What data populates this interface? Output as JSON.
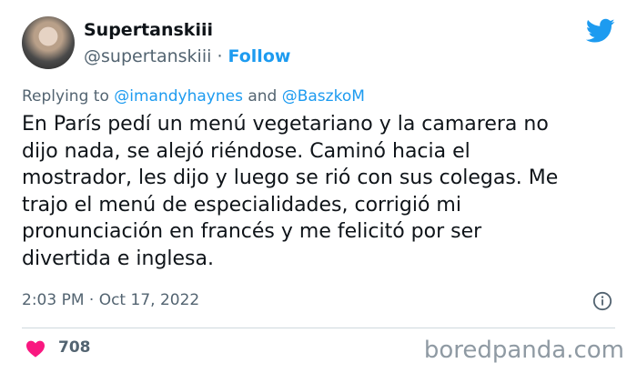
{
  "author": {
    "name": "Supertanskiii",
    "handle": "@supertanskiii",
    "separator": "·",
    "follow_label": "Follow"
  },
  "reply": {
    "prefix": "Replying to",
    "mention1": "@imandyhaynes",
    "joiner": "and",
    "mention2": "@BaszkoM"
  },
  "tweet": {
    "lines": [
      "En París pedí un menú vegetariano y la camarera no",
      "dijo nada, se alejó riéndose. Caminó hacia el",
      "mostrador, les dijo y luego se rió con sus colegas. Me",
      "trajo el menú de especialidades, corrigió mi",
      "pronunciación en francés y me felicitó por ser",
      "divertida e inglesa."
    ],
    "timestamp": "2:03 PM · Oct 17, 2022"
  },
  "engagement": {
    "likes": "708"
  },
  "watermark": "boredpanda.com",
  "icons": {
    "brand": "twitter-bird-icon",
    "info": "info-icon",
    "like": "heart-icon"
  },
  "colors": {
    "accent": "#1d9bf0",
    "heart": "#f91880",
    "secondary_text": "#536471"
  }
}
